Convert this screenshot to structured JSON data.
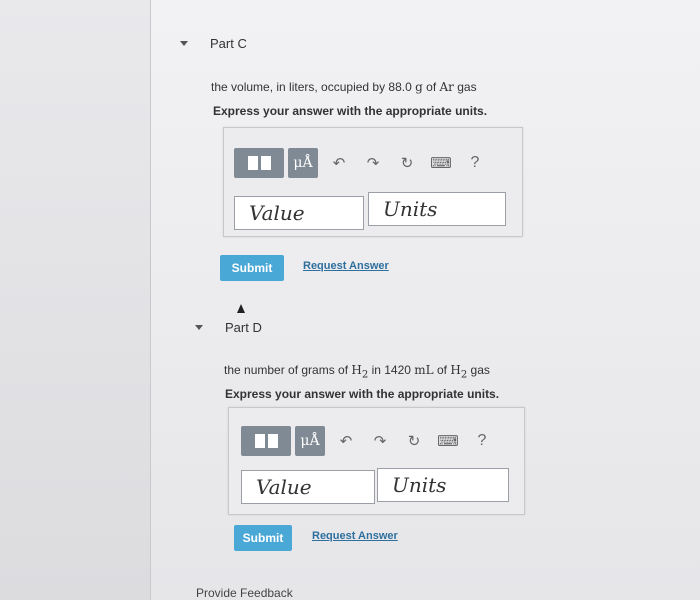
{
  "partC": {
    "title": "Part C",
    "prompt_pre": "the volume, in liters, occupied by 88.0 ",
    "prompt_unit": "g",
    "prompt_mid": " of ",
    "prompt_species": "Ar",
    "prompt_post": " gas",
    "instruction": "Express your answer with the appropriate units.",
    "toolbar": {
      "units_label": "μÅ",
      "help_label": "?"
    },
    "value_placeholder": "Value",
    "units_placeholder": "Units",
    "submit_label": "Submit",
    "request_label": "Request Answer"
  },
  "partD": {
    "title": "Part D",
    "prompt_pre": "the number of grams of ",
    "prompt_h2_a": "H",
    "prompt_h2_a_sub": "2",
    "prompt_mid": " in 1420 ",
    "prompt_unit": "mL",
    "prompt_mid2": " of ",
    "prompt_h2_b": "H",
    "prompt_h2_b_sub": "2",
    "prompt_post": " gas",
    "instruction": "Express your answer with the appropriate units.",
    "toolbar": {
      "units_label": "μÅ",
      "help_label": "?"
    },
    "value_placeholder": "Value",
    "units_placeholder": "Units",
    "submit_label": "Submit",
    "request_label": "Request Answer"
  },
  "footer": {
    "feedback_label": "Provide Feedback"
  }
}
